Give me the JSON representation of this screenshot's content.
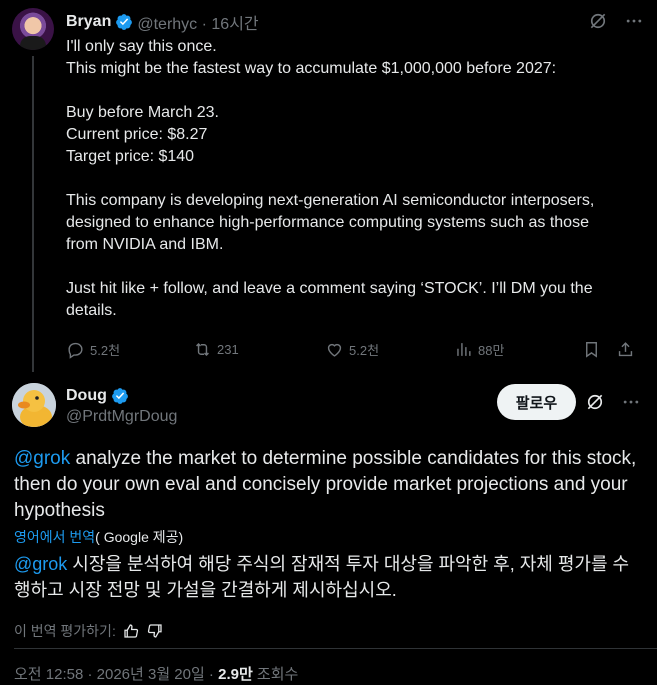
{
  "colors": {
    "background": "#000000",
    "text": "#e7e9ea",
    "muted": "#71767b",
    "accent": "#1d9bf0",
    "divider": "#2f3336"
  },
  "tweet1": {
    "name": "Bryan",
    "handle_time": "@terhyc · 16시간",
    "icons": [
      "grok-icon",
      "more-icon"
    ],
    "lines": [
      "I'll only say this once.",
      "This might be the fastest way to accumulate $1,000,000 before 2027:",
      "",
      "Buy before March 23.",
      "Current price: $8.27",
      "Target price: $140",
      "",
      "This company is developing next-generation AI semiconductor interposers,",
      "designed to enhance high-performance computing systems such as those",
      "from NVIDIA and IBM.",
      "",
      "Just hit like + follow, and leave a comment saying ‘STOCK’. I’ll DM you the",
      "details."
    ],
    "actions": {
      "replies": "5.2천",
      "reposts": "231",
      "likes": "5.2천",
      "views": "88만"
    }
  },
  "tweet2": {
    "name": "Doug",
    "handle": "@PrdtMgrDoug",
    "follow_label": "팔로우",
    "mention": "@grok",
    "text_en": " analyze the market to determine possible candidates for this stock, then do your own eval and concisely provide market projections and your hypothesis",
    "translate_link": "영어에서 번역",
    "translate_by": "( Google 제공)",
    "text_ko": " 시장을 분석하여 해당 주식의 잠재적 투자 대상을 파악한 후, 자체 평가를 수행하고 시장 전망 및 가설을 간결하게 제시하십시오.",
    "rate_label": "이 번역 평가하기:",
    "meta": {
      "time": "오전 12:58 · 2026년 3월 20일 · ",
      "views": "2.9만",
      "views_label": " 조회수"
    }
  }
}
